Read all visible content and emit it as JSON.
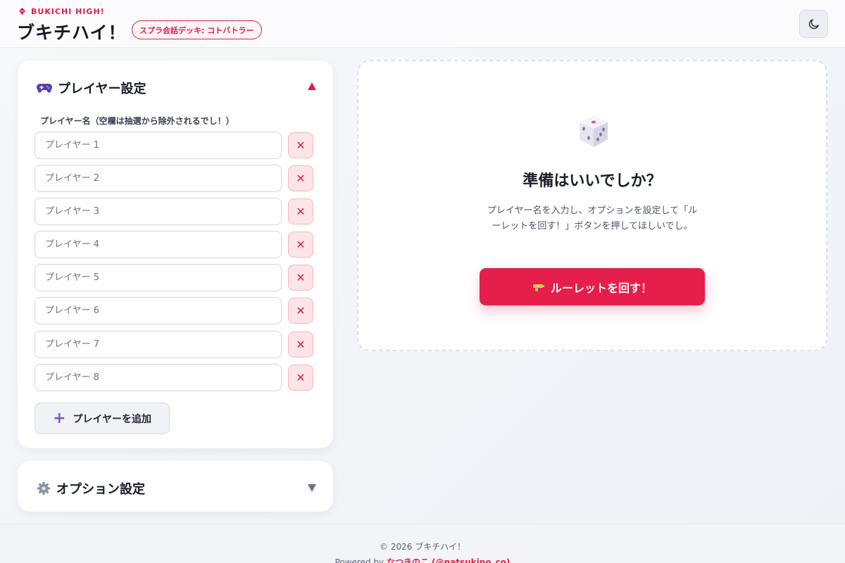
{
  "header": {
    "brand_small": "BUKICHI HIGH!",
    "title": "ブキチハイ！",
    "deck_badge": "スプラ会話デッキ: コトバトラー"
  },
  "player_section": {
    "title": "プレイヤー設定",
    "label": "プレイヤー名（空欄は抽選から除外されるでし！）",
    "players": [
      {
        "value": "",
        "placeholder": "プレイヤー 1"
      },
      {
        "value": "",
        "placeholder": "プレイヤー 2"
      },
      {
        "value": "",
        "placeholder": "プレイヤー 3"
      },
      {
        "value": "",
        "placeholder": "プレイヤー 4"
      },
      {
        "value": "",
        "placeholder": "プレイヤー 5"
      },
      {
        "value": "",
        "placeholder": "プレイヤー 6"
      },
      {
        "value": "",
        "placeholder": "プレイヤー 7"
      },
      {
        "value": "",
        "placeholder": "プレイヤー 8"
      }
    ],
    "add_button": "プレイヤーを追加"
  },
  "option_section": {
    "title": "オプション設定"
  },
  "roulette": {
    "title": "準備はいいでしか？",
    "description": "プレイヤー名を入力し、オプションを設定して「ルーレットを回す！」ボタンを押してほしいでし。",
    "spin_button": "ルーレットを回す！"
  },
  "footer": {
    "copyright": "© 2026 ブキチハイ！",
    "powered_prefix": "Powered by ",
    "author": "なつきのこ (@natsukino_co)"
  },
  "colors": {
    "accent": "#e11d48",
    "spin_button": "#e61e4b",
    "remove_bg": "#fde4e7"
  }
}
